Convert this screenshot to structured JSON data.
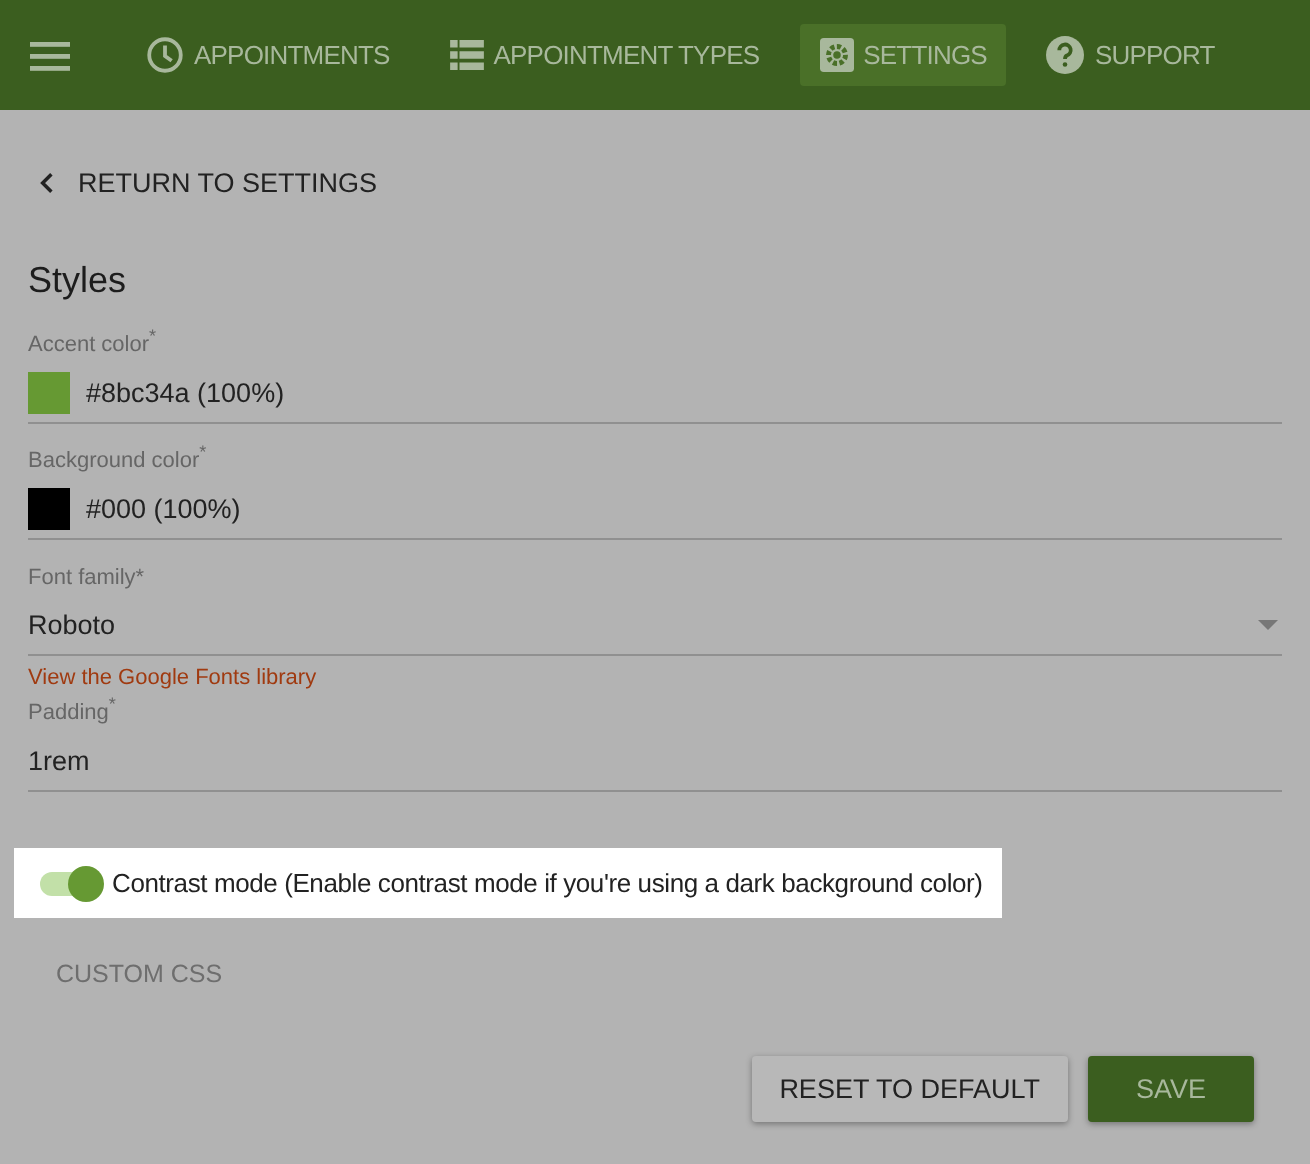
{
  "nav": {
    "tabs": [
      {
        "label": "APPOINTMENTS",
        "kind": "clock",
        "selected": false
      },
      {
        "label": "APPOINTMENT TYPES",
        "kind": "list",
        "selected": false
      },
      {
        "label": "SETTINGS",
        "kind": "gear",
        "selected": true
      },
      {
        "label": "SUPPORT",
        "kind": "help",
        "selected": false
      }
    ]
  },
  "back_link": "RETURN TO SETTINGS",
  "section_title": "Styles",
  "fields": [
    {
      "kind": "color",
      "label": "Accent color$^{*}$",
      "value": "#8bc34a (100%)",
      "color": "#669933"
    },
    {
      "kind": "color",
      "label": "Background color$^{*}$",
      "value": "#000 (100%)",
      "color": "#000000"
    },
    {
      "kind": "select",
      "label": "Font family*",
      "value": "Roboto",
      "link": "View the Google Fonts library"
    },
    {
      "kind": "text",
      "label": "Padding$^{*}$",
      "value": "1rem"
    }
  ],
  "toggle": {
    "label": "Contrast mode (Enable contrast mode if you're using a dark background color)",
    "on": true,
    "highlighted": true
  },
  "custom_css": "CUSTOM CSS",
  "buttons": [
    {
      "label": "RESET TO DEFAULT",
      "kind": "secondary"
    },
    {
      "label": "SAVE",
      "kind": "primary"
    }
  ]
}
